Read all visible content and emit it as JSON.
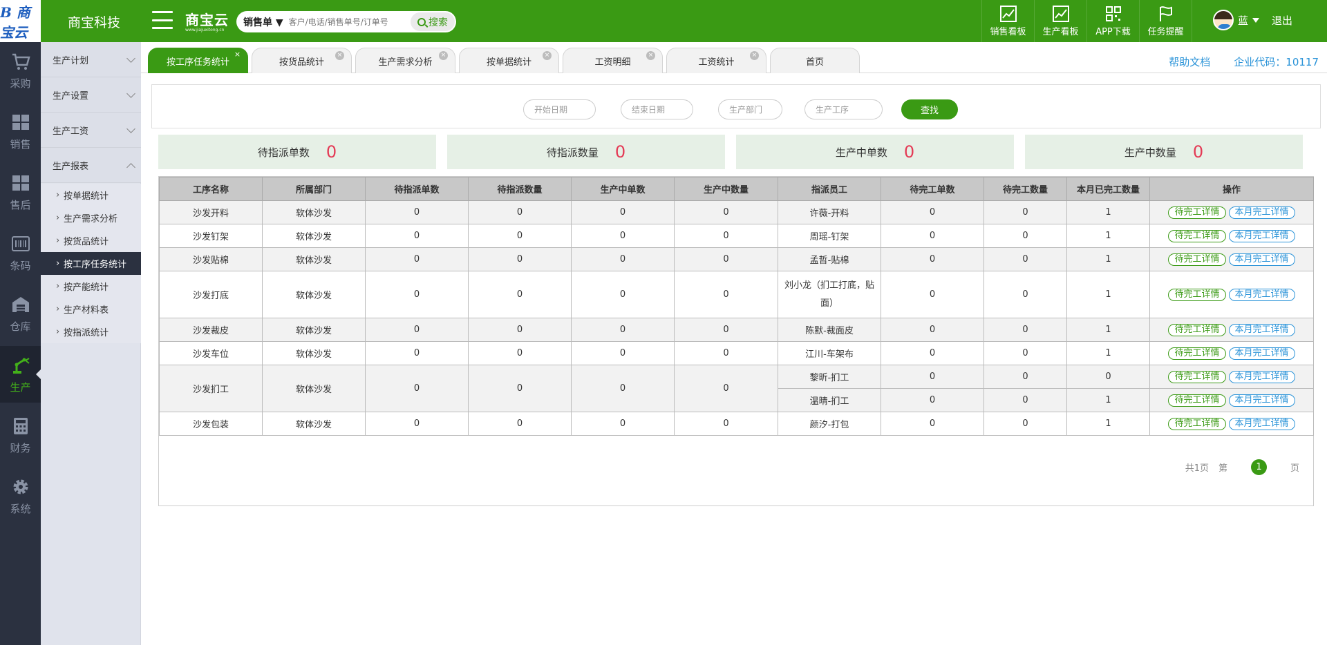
{
  "topbar": {
    "logo_text": "B 商宝云",
    "brand": "商宝科技",
    "cloud_title": "商宝云",
    "cloud_url": "www.jiajuxitong.cn",
    "search_type": "销售单",
    "search_placeholder": "客户/电话/销售单号/订单号",
    "search_button": "搜索",
    "nav": [
      {
        "label": "销售看板",
        "icon": "chart-line-icon"
      },
      {
        "label": "生产看板",
        "icon": "chart-line-icon"
      },
      {
        "label": "APP下载",
        "icon": "qrcode-icon"
      },
      {
        "label": "任务提醒",
        "icon": "flag-icon"
      }
    ],
    "user_name": "蓝",
    "logout": "退出"
  },
  "iconbar": [
    {
      "label": "采购",
      "icon": "cart-icon"
    },
    {
      "label": "销售",
      "icon": "boxes-icon"
    },
    {
      "label": "售后",
      "icon": "boxes-icon"
    },
    {
      "label": "条码",
      "icon": "barcode-icon"
    },
    {
      "label": "仓库",
      "icon": "warehouse-icon"
    },
    {
      "label": "生产",
      "icon": "robot-arm-icon",
      "active": true
    },
    {
      "label": "财务",
      "icon": "calculator-icon"
    },
    {
      "label": "系统",
      "icon": "gear-icon"
    }
  ],
  "submenu": {
    "groups": [
      "生产计划",
      "生产设置",
      "生产工资",
      "生产报表"
    ],
    "items": [
      "按单据统计",
      "生产需求分析",
      "按货品统计",
      "按工序任务统计",
      "按产能统计",
      "生产材料表",
      "按指派统计"
    ],
    "active_item": "按工序任务统计"
  },
  "tabs": [
    {
      "label": "按工序任务统计",
      "active": true
    },
    {
      "label": "按货品统计"
    },
    {
      "label": "生产需求分析"
    },
    {
      "label": "按单据统计"
    },
    {
      "label": "工资明细"
    },
    {
      "label": "工资统计"
    },
    {
      "label": "首页"
    }
  ],
  "links": {
    "help": "帮助文档",
    "company_code": "企业代码：10117"
  },
  "filters": {
    "start_date": "开始日期",
    "end_date": "结束日期",
    "department": "生产部门",
    "process": "生产工序",
    "search_button": "查找"
  },
  "summary": [
    {
      "label": "待指派单数",
      "value": "0"
    },
    {
      "label": "待指派数量",
      "value": "0"
    },
    {
      "label": "生产中单数",
      "value": "0"
    },
    {
      "label": "生产中数量",
      "value": "0"
    }
  ],
  "table": {
    "headers": [
      "工序名称",
      "所属部门",
      "待指派单数",
      "待指派数量",
      "生产中单数",
      "生产中数量",
      "指派员工",
      "待完工单数",
      "待完工数量",
      "本月已完工数量",
      "操作"
    ],
    "op_pending": "待完工详情",
    "op_done": "本月完工详情",
    "rows": [
      {
        "name": "沙发开料",
        "dept": "软体沙发",
        "a": "0",
        "b": "0",
        "c": "0",
        "d": "0",
        "staff": [
          {
            "who": "许薇-开料",
            "e": "0",
            "f": "0",
            "g": "1"
          }
        ]
      },
      {
        "name": "沙发钉架",
        "dept": "软体沙发",
        "a": "0",
        "b": "0",
        "c": "0",
        "d": "0",
        "staff": [
          {
            "who": "周瑶-钉架",
            "e": "0",
            "f": "0",
            "g": "1"
          }
        ]
      },
      {
        "name": "沙发贴棉",
        "dept": "软体沙发",
        "a": "0",
        "b": "0",
        "c": "0",
        "d": "0",
        "staff": [
          {
            "who": "孟哲-贴棉",
            "e": "0",
            "f": "0",
            "g": "1"
          }
        ]
      },
      {
        "name": "沙发打底",
        "dept": "软体沙发",
        "a": "0",
        "b": "0",
        "c": "0",
        "d": "0",
        "staff": [
          {
            "who": "刘小龙（扪工打底，贴面）",
            "e": "0",
            "f": "0",
            "g": "1"
          }
        ]
      },
      {
        "name": "沙发裁皮",
        "dept": "软体沙发",
        "a": "0",
        "b": "0",
        "c": "0",
        "d": "0",
        "staff": [
          {
            "who": "陈默-裁面皮",
            "e": "0",
            "f": "0",
            "g": "1"
          }
        ]
      },
      {
        "name": "沙发车位",
        "dept": "软体沙发",
        "a": "0",
        "b": "0",
        "c": "0",
        "d": "0",
        "staff": [
          {
            "who": "江川-车架布",
            "e": "0",
            "f": "0",
            "g": "1"
          }
        ]
      },
      {
        "name": "沙发扪工",
        "dept": "软体沙发",
        "a": "0",
        "b": "0",
        "c": "0",
        "d": "0",
        "staff": [
          {
            "who": "黎昕-扪工",
            "e": "0",
            "f": "0",
            "g": "0"
          },
          {
            "who": "温晴-扪工",
            "e": "0",
            "f": "0",
            "g": "1"
          }
        ]
      },
      {
        "name": "沙发包装",
        "dept": "软体沙发",
        "a": "0",
        "b": "0",
        "c": "0",
        "d": "0",
        "staff": [
          {
            "who": "颜汐-打包",
            "e": "0",
            "f": "0",
            "g": "1"
          }
        ]
      }
    ]
  },
  "pager": {
    "total": "共1页",
    "page_prefix": "第",
    "current": "1",
    "page_suffix": "页"
  },
  "colors": {
    "brand_green": "#3a9a14",
    "sidebar_dark": "#2b3140",
    "link_blue": "#2a93d8",
    "number_red": "#e43a55"
  }
}
